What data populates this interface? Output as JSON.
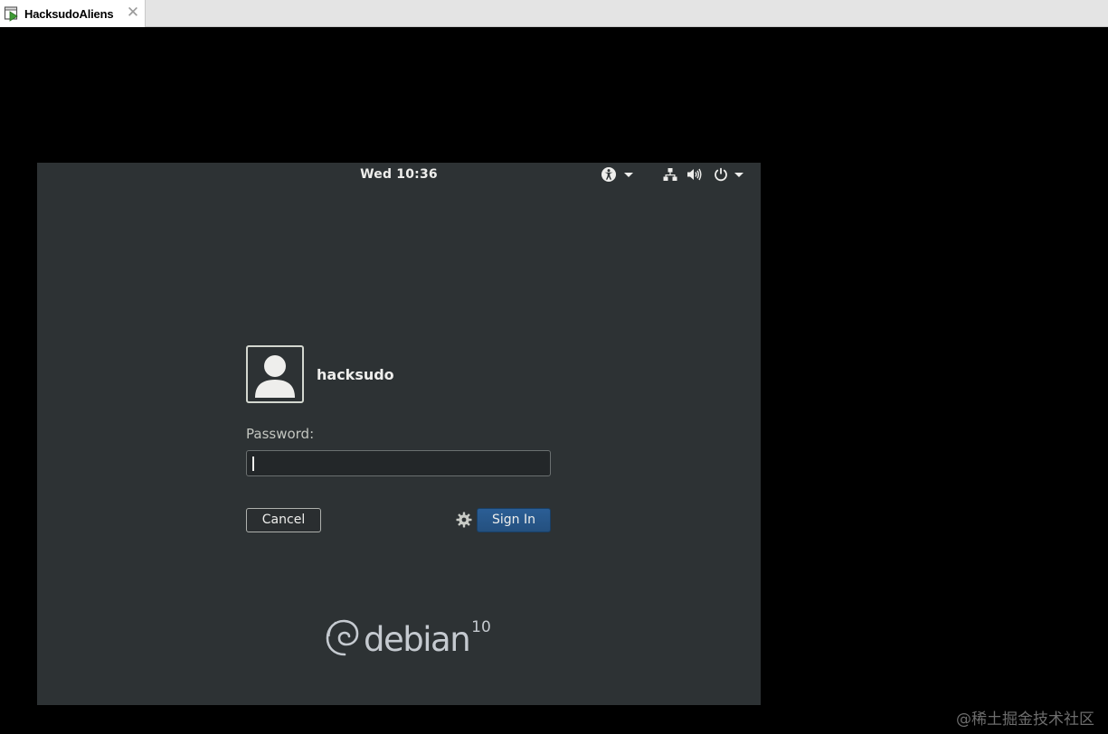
{
  "host": {
    "tab_title": "HacksudoAliens",
    "tab_close": "✕",
    "tab_icon": "vm-play-icon"
  },
  "vm": {
    "topbar": {
      "clock": "Wed 10:36",
      "indicators": [
        "accessibility-icon",
        "network-icon",
        "volume-icon",
        "power-icon"
      ]
    },
    "login": {
      "username": "hacksudo",
      "password_label": "Password:",
      "password_value": "",
      "cancel_label": "Cancel",
      "signin_label": "Sign In"
    },
    "branding": {
      "wordmark": "debian",
      "version": "10"
    }
  },
  "watermark": "@稀土掘金技术社区",
  "colors": {
    "vm_background": "#2d3234",
    "signin_button": "#2b5e95",
    "text": "#eeeeec"
  }
}
